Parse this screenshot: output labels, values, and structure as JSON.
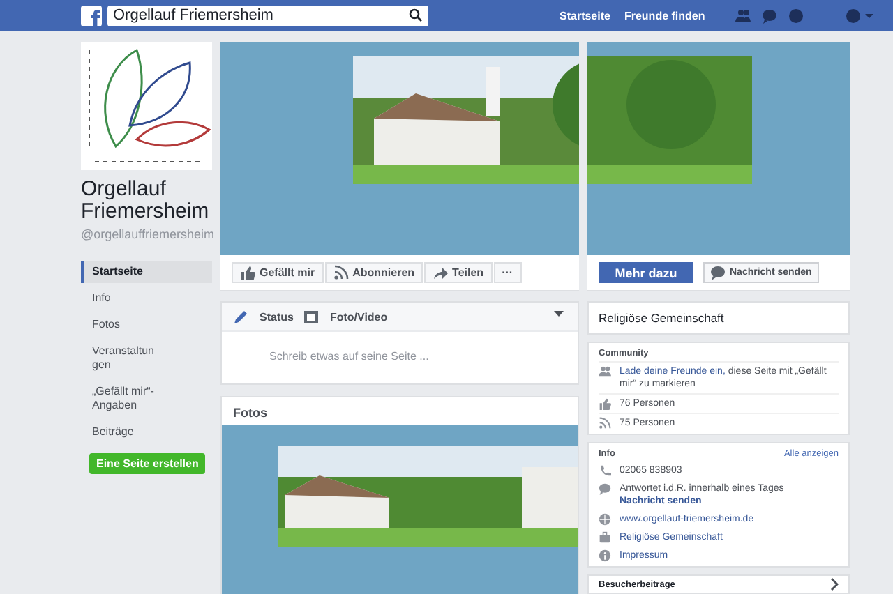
{
  "topbar": {
    "search": {
      "value": "Orgellauf Friemersheim"
    },
    "links": [
      "Startseite",
      "Freunde finden"
    ]
  },
  "sidebar": {
    "page_name": "Orgellauf Friemersheim",
    "handle": "@orgellauffriemersheim",
    "nav": [
      {
        "label": "Startseite",
        "selected": true
      },
      {
        "label": "Info",
        "selected": false
      },
      {
        "label": "Fotos",
        "selected": false
      },
      {
        "label": "Veranstaltun gen",
        "selected": false
      },
      {
        "label": "„Gefällt mir“-Angaben",
        "selected": false
      },
      {
        "label": "Beiträge",
        "selected": false
      }
    ],
    "create_button": "Eine Seite erstellen"
  },
  "actions": [
    {
      "kind": "like",
      "label": "Gefällt mir"
    },
    {
      "kind": "follow",
      "label": "Abonnieren"
    },
    {
      "kind": "share",
      "label": "Teilen"
    },
    {
      "kind": "more",
      "label": "···"
    }
  ],
  "cta": {
    "primary": "Mehr dazu",
    "message": "Nachricht senden"
  },
  "composer": {
    "tabs": [
      {
        "kind": "status",
        "label": "Status"
      },
      {
        "kind": "photo",
        "label": "Foto/Video"
      }
    ],
    "placeholder": "Schreib etwas auf seine Seite ..."
  },
  "photos": {
    "title": "Fotos"
  },
  "category": "Religiöse Gemeinschaft",
  "community": {
    "title": "Community",
    "invite_link": "Lade deine Freunde ein,",
    "invite_text": " diese Seite mit „Gefällt mir“ zu markieren",
    "rows": [
      {
        "kind": "likes",
        "text": "76 Personen"
      },
      {
        "kind": "follows",
        "text": "75 Personen"
      }
    ]
  },
  "info": {
    "title": "Info",
    "see_all": "Alle anzeigen",
    "rows": [
      {
        "kind": "phone",
        "text": "02065 838903"
      },
      {
        "kind": "message",
        "text": "Antwortet i.d.R. innerhalb eines Tages",
        "link": "Nachricht senden"
      },
      {
        "kind": "web",
        "link": "www.orgellauf-friemersheim.de"
      },
      {
        "kind": "category",
        "link": "Religiöse Gemeinschaft"
      },
      {
        "kind": "about",
        "link": "Impressum"
      }
    ]
  },
  "visitor_posts": {
    "title": "Besucherbeiträge"
  }
}
